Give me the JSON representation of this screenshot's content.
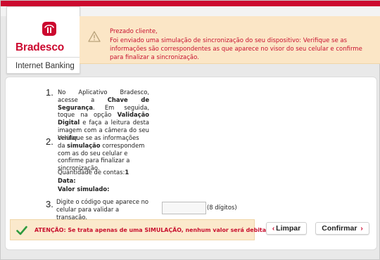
{
  "brand": {
    "name": "Bradesco",
    "subtitle": "Internet Banking",
    "color": "#cc092f"
  },
  "alert": {
    "icon": "warning-triangle-icon",
    "title": "Prezado cliente,",
    "message": "Foi enviado uma simulação de sincronização do seu dispositivo: Verifique se as informações são correspondentes as que aparece no visor do seu celular e confirme para finalizar a sincronização."
  },
  "steps": {
    "step1": {
      "number": "1.",
      "text_a": "No Aplicativo Bradesco, acesse a ",
      "bold_a": "Chave de Segurança",
      "text_b": ". Em seguida, toque na opção ",
      "bold_b": "Validação Digital",
      "text_c": " e faça a leitura desta imagem com a câmera do seu celular."
    },
    "step2": {
      "number": "2.",
      "text_a": "Verifique se as informações da ",
      "bold_a": "simulação",
      "text_b": " correspondem com as do seu celular e confirme para finalizar a sincronização."
    },
    "step3": {
      "number": "3.",
      "text": "Digite o código que aparece no celular para validar a transação.",
      "input_value": "",
      "hint": "(8 dígitos)"
    }
  },
  "simulation": {
    "qty_label": "Quantidade de contas:",
    "qty_value": "1",
    "date_label": "Data:",
    "value_label": "Valor simulado:"
  },
  "warning": {
    "icon": "checkmark-icon",
    "text": "ATENÇÃO: Se trata apenas de uma SIMULAÇÃO, nenhum valor será debitado."
  },
  "buttons": {
    "clear": "Limpar",
    "confirm": "Confirmar"
  }
}
